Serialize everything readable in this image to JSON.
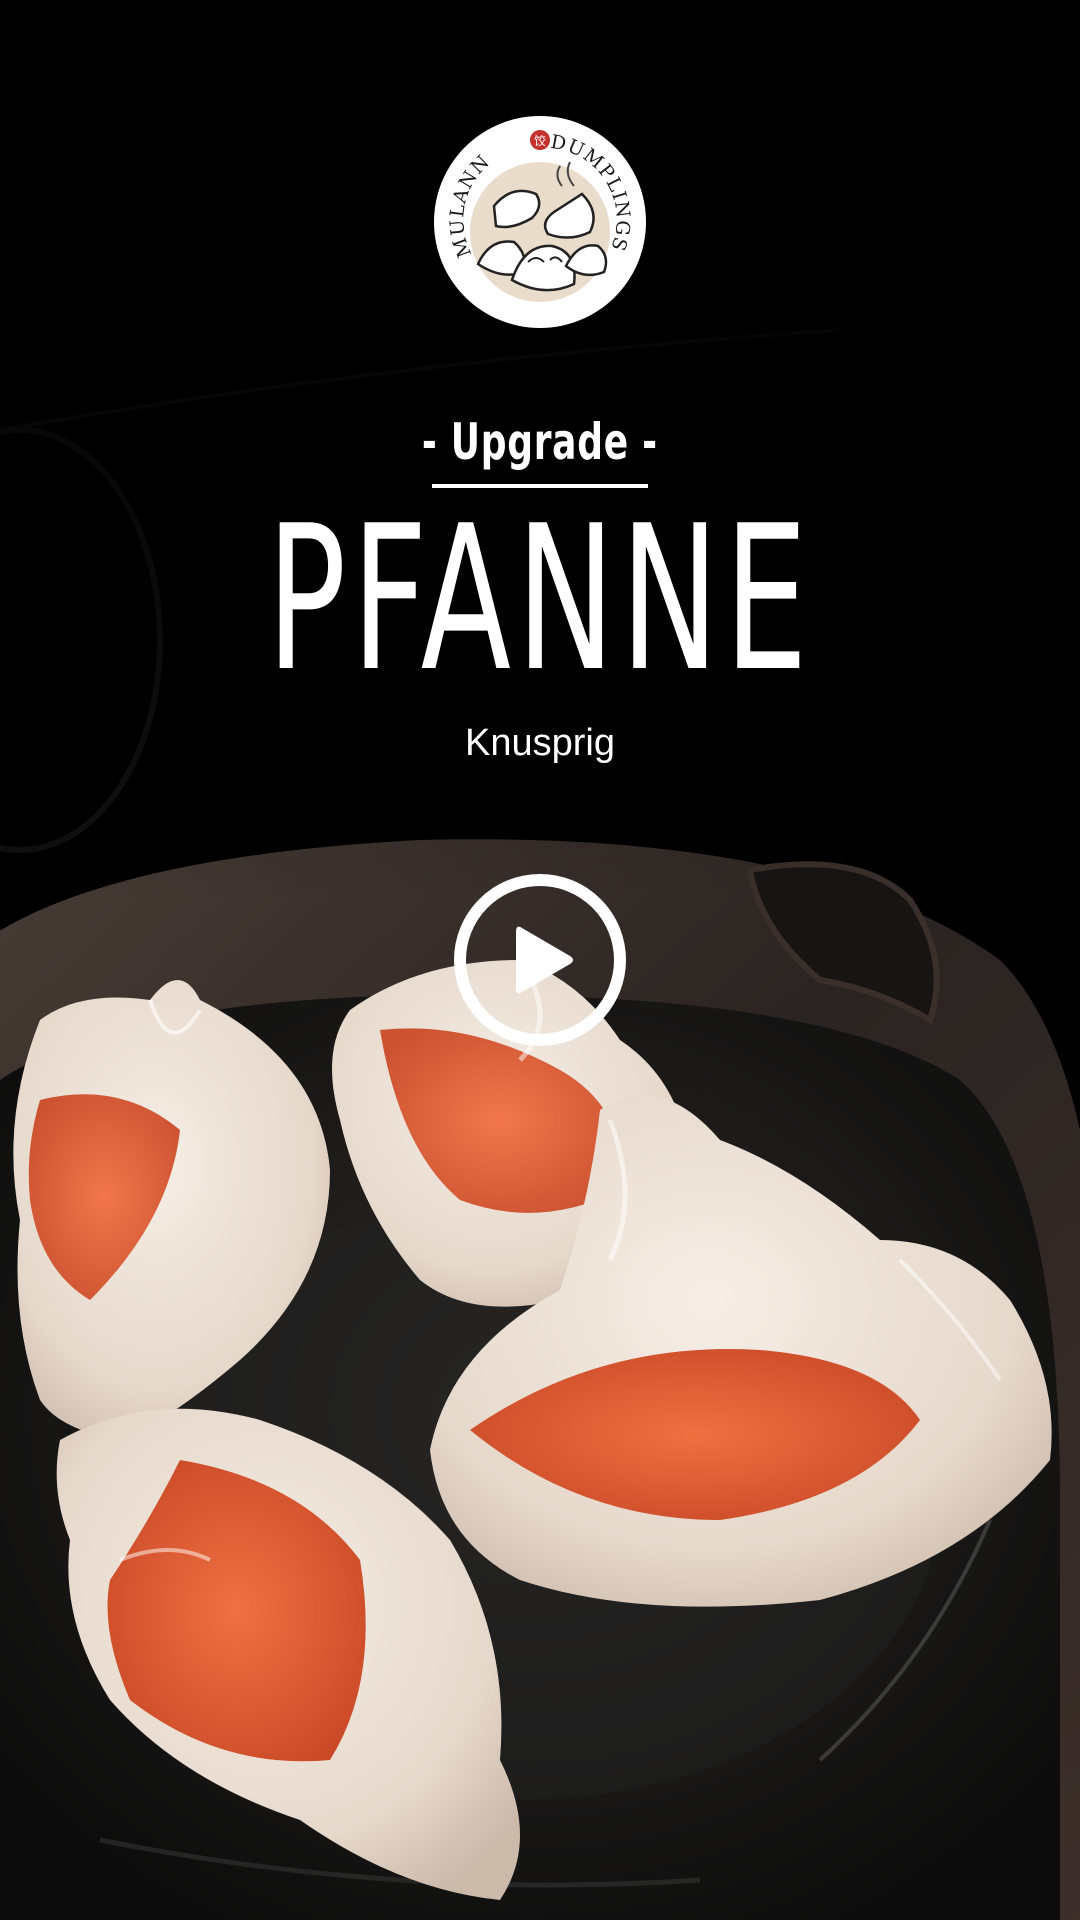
{
  "brand": {
    "name_left": "MULANN",
    "name_right": "DUMPLINGS",
    "seal_glyph": "饺",
    "accent_color": "#c4302b"
  },
  "hero": {
    "kicker": "- Upgrade -",
    "title": "PFANNE",
    "subtitle": "Knusprig"
  },
  "player": {
    "icon": "play-icon"
  },
  "colors": {
    "background": "#000000",
    "text": "#ffffff",
    "dough": "#eadfd3",
    "filling": "#e0552e",
    "pan": "#1c1a19"
  }
}
